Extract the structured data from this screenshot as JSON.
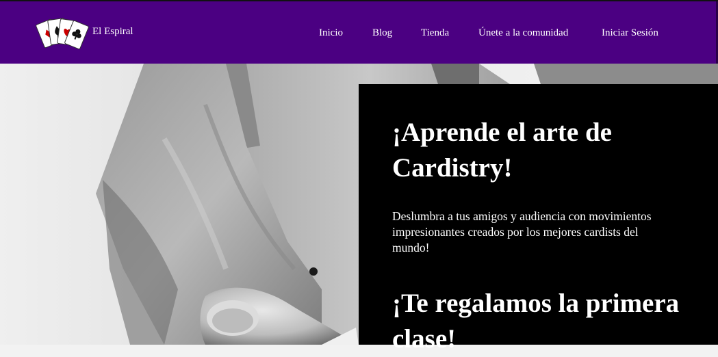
{
  "header": {
    "brand": "El Espiral",
    "logo_icon": "playing-cards-fan-icon",
    "background_color": "#4b0082",
    "nav": [
      {
        "label": "Inicio"
      },
      {
        "label": "Blog"
      },
      {
        "label": "Tienda"
      },
      {
        "label": "Únete a la comunidad"
      },
      {
        "label": "Iniciar Sesión"
      }
    ]
  },
  "hero": {
    "image": "black-and-white-photo-of-person-in-grey-jacket-holding-card",
    "title": "¡Aprende el arte de Cardistry!",
    "description": "Deslumbra a tus amigos y audiencia con movimientos impresionantes creados por los mejores cardists del mundo!",
    "subtitle": "¡Te regalamos la primera clase!",
    "panel_color": "#000000",
    "text_color": "#ffffff"
  }
}
